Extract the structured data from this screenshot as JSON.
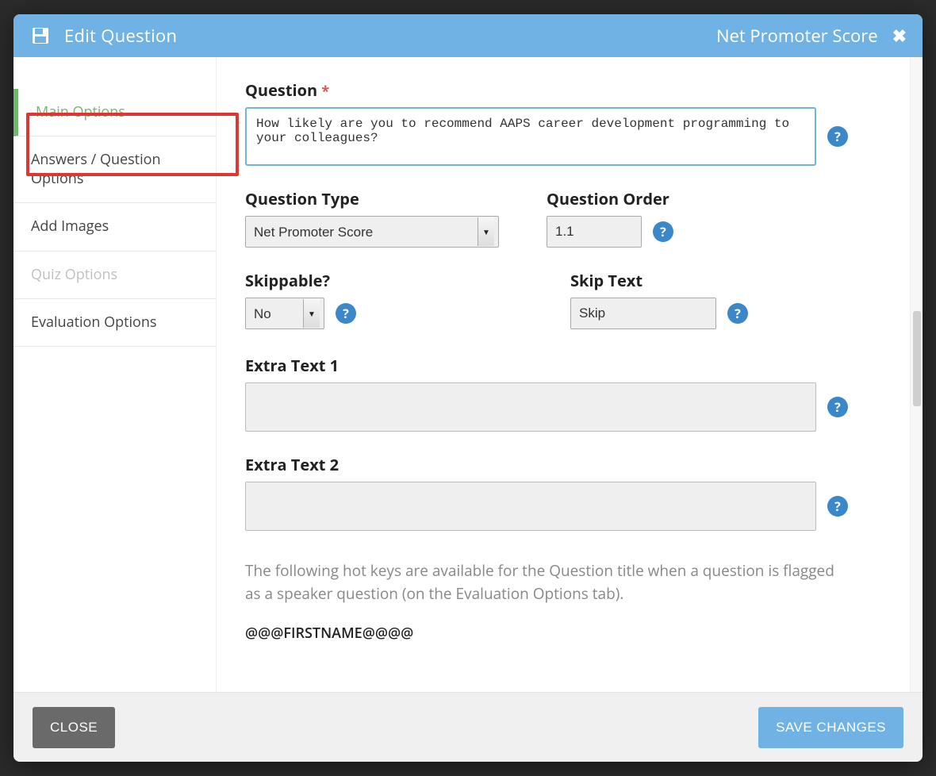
{
  "header": {
    "title": "Edit Question",
    "type_label": "Net Promoter Score"
  },
  "sidebar": {
    "items": [
      {
        "label": "Main Options",
        "active": true
      },
      {
        "label": "Answers / Question Options"
      },
      {
        "label": "Add Images"
      },
      {
        "label": "Quiz Options",
        "disabled": true
      },
      {
        "label": "Evaluation Options"
      }
    ]
  },
  "form": {
    "question_label": "Question",
    "question_value": "How likely are you to recommend AAPS career development programming to your colleagues?",
    "question_type_label": "Question Type",
    "question_type_value": "Net Promoter Score",
    "question_order_label": "Question Order",
    "question_order_value": "1.1",
    "skippable_label": "Skippable?",
    "skippable_value": "No",
    "skip_text_label": "Skip Text",
    "skip_text_value": "Skip",
    "extra1_label": "Extra Text 1",
    "extra1_value": "",
    "extra2_label": "Extra Text 2",
    "extra2_value": "",
    "hint": "The following hot keys are available for the Question title when a question is flagged as a speaker question (on the Evaluation Options tab).",
    "hotkey1": "@@@FIRSTNAME@@@@"
  },
  "footer": {
    "close_label": "CLOSE",
    "save_label": "SAVE CHANGES"
  }
}
